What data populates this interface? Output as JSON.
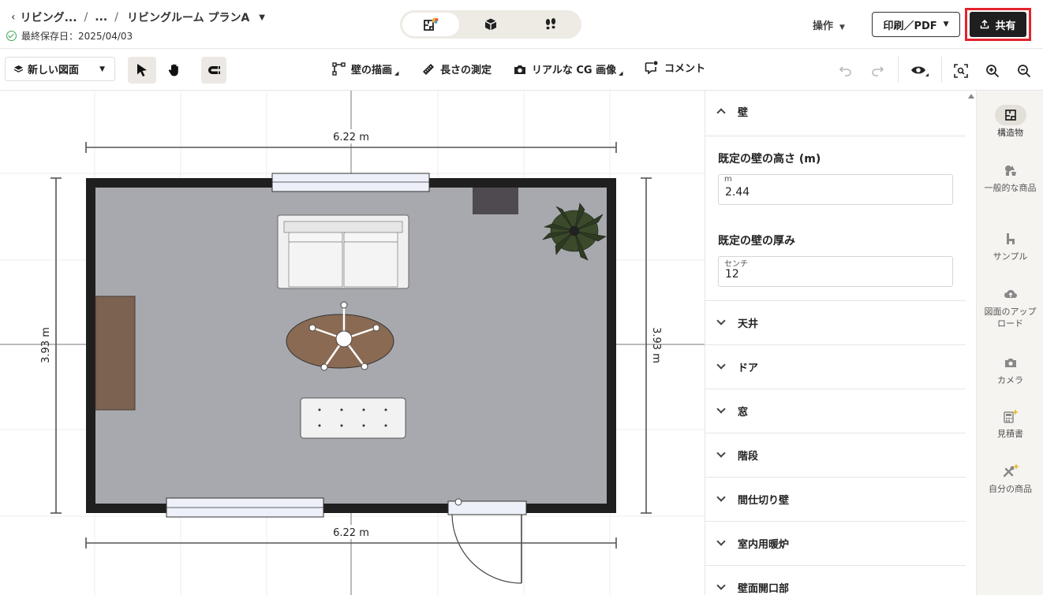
{
  "header": {
    "breadcrumb_root": "リビング...",
    "breadcrumb_sep": "/",
    "breadcrumb_mid": "...",
    "plan_name": "リビングルーム プランA",
    "saved_text": "最終保存日：2025/04/03",
    "operations_label": "操作",
    "print_label": "印刷／PDF",
    "share_label": "共有"
  },
  "view_switch": {
    "active": "2d-floorplan",
    "icons": [
      "floorplan-2d-icon",
      "box-3d-icon",
      "footsteps-icon"
    ]
  },
  "toolbar": {
    "new_plan_label": "新しい図面",
    "draw_wall_label": "壁の描画",
    "measure_label": "長さの測定",
    "render_label": "リアルな CG 画像",
    "comment_label": "コメント"
  },
  "canvas": {
    "width_top": "6.22 m",
    "width_bottom": "6.22 m",
    "height_left": "3.93 m",
    "height_right": "3.93 m",
    "floor_color": "#a7a9ae",
    "wall_color": "#1f1f1f"
  },
  "panel": {
    "wall_section": "壁",
    "default_height_label": "既定の壁の高さ (m)",
    "height_unit": "m",
    "height_value": "2.44",
    "default_thickness_label": "既定の壁の厚み",
    "thickness_unit": "センチ",
    "thickness_value": "12",
    "sections": [
      "天井",
      "ドア",
      "窓",
      "階段",
      "間仕切り壁",
      "室内用暖炉",
      "壁面開口部"
    ]
  },
  "sidebar": {
    "items": [
      {
        "label": "構造物",
        "icon": "structure-icon"
      },
      {
        "label": "一般的な商品",
        "icon": "products-icon"
      },
      {
        "label": "サンプル",
        "icon": "chair-icon"
      },
      {
        "label": "図面のアップロード",
        "icon": "cloud-upload-icon"
      },
      {
        "label": "カメラ",
        "icon": "camera-icon"
      },
      {
        "label": "見積書",
        "icon": "calculator-icon"
      },
      {
        "label": "自分の商品",
        "icon": "tools-icon"
      }
    ]
  },
  "colors": {
    "accent_highlight": "#e3242b",
    "share_bg": "#1f1f1f",
    "sidebar_bg": "#f6f4f1"
  }
}
